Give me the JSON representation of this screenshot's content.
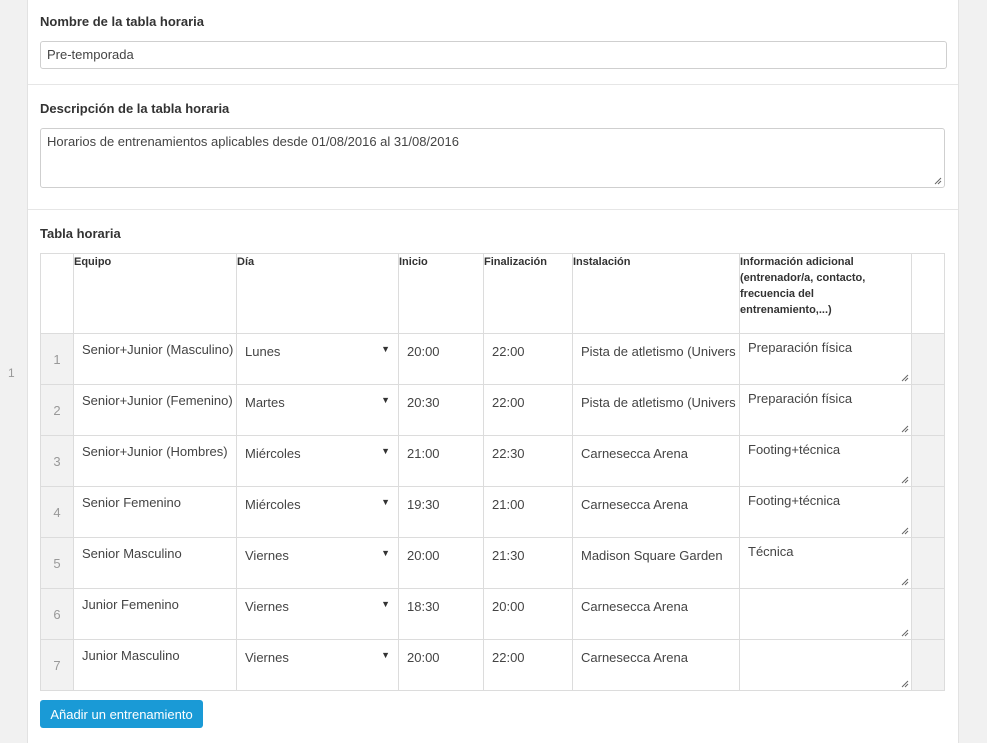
{
  "gutter": {
    "number": "1"
  },
  "name_field": {
    "label": "Nombre de la tabla horaria",
    "value": "Pre-temporada"
  },
  "description_field": {
    "label": "Descripción de la tabla horaria",
    "value": "Horarios de entrenamientos aplicables desde 01/08/2016 al 31/08/2016"
  },
  "schedule": {
    "label": "Tabla horaria",
    "columns": {
      "team": "Equipo",
      "day": "Día",
      "start": "Inicio",
      "end": "Finalización",
      "venue": "Instalación",
      "info": "Información adicional (entrenador/a, contacto, frecuencia del entrenamiento,...)"
    },
    "rows": [
      {
        "num": "1",
        "team": "Senior+Junior (Masculino)",
        "day": "Lunes",
        "start": "20:00",
        "end": "22:00",
        "venue": "Pista de atletismo (Univers",
        "info": "Preparación física"
      },
      {
        "num": "2",
        "team": "Senior+Junior (Femenino)",
        "day": "Martes",
        "start": "20:30",
        "end": "22:00",
        "venue": "Pista de atletismo (Univers",
        "info": "Preparación física"
      },
      {
        "num": "3",
        "team": "Senior+Junior (Hombres)",
        "day": "Miércoles",
        "start": "21:00",
        "end": "22:30",
        "venue": "Carnesecca Arena",
        "info": "Footing+técnica"
      },
      {
        "num": "4",
        "team": "Senior Femenino",
        "day": "Miércoles",
        "start": "19:30",
        "end": "21:00",
        "venue": "Carnesecca Arena",
        "info": "Footing+técnica"
      },
      {
        "num": "5",
        "team": "Senior Masculino",
        "day": "Viernes",
        "start": "20:00",
        "end": "21:30",
        "venue": "Madison Square Garden",
        "info": "Técnica"
      },
      {
        "num": "6",
        "team": "Junior Femenino",
        "day": "Viernes",
        "start": "18:30",
        "end": "20:00",
        "venue": "Carnesecca Arena",
        "info": ""
      },
      {
        "num": "7",
        "team": "Junior Masculino",
        "day": "Viernes",
        "start": "20:00",
        "end": "22:00",
        "venue": "Carnesecca Arena",
        "info": ""
      }
    ],
    "dropdown_icon": "triangle-down"
  },
  "add_button": {
    "label": "Añadir un entrenamiento"
  },
  "colors": {
    "accent": "#1a9ad6"
  }
}
